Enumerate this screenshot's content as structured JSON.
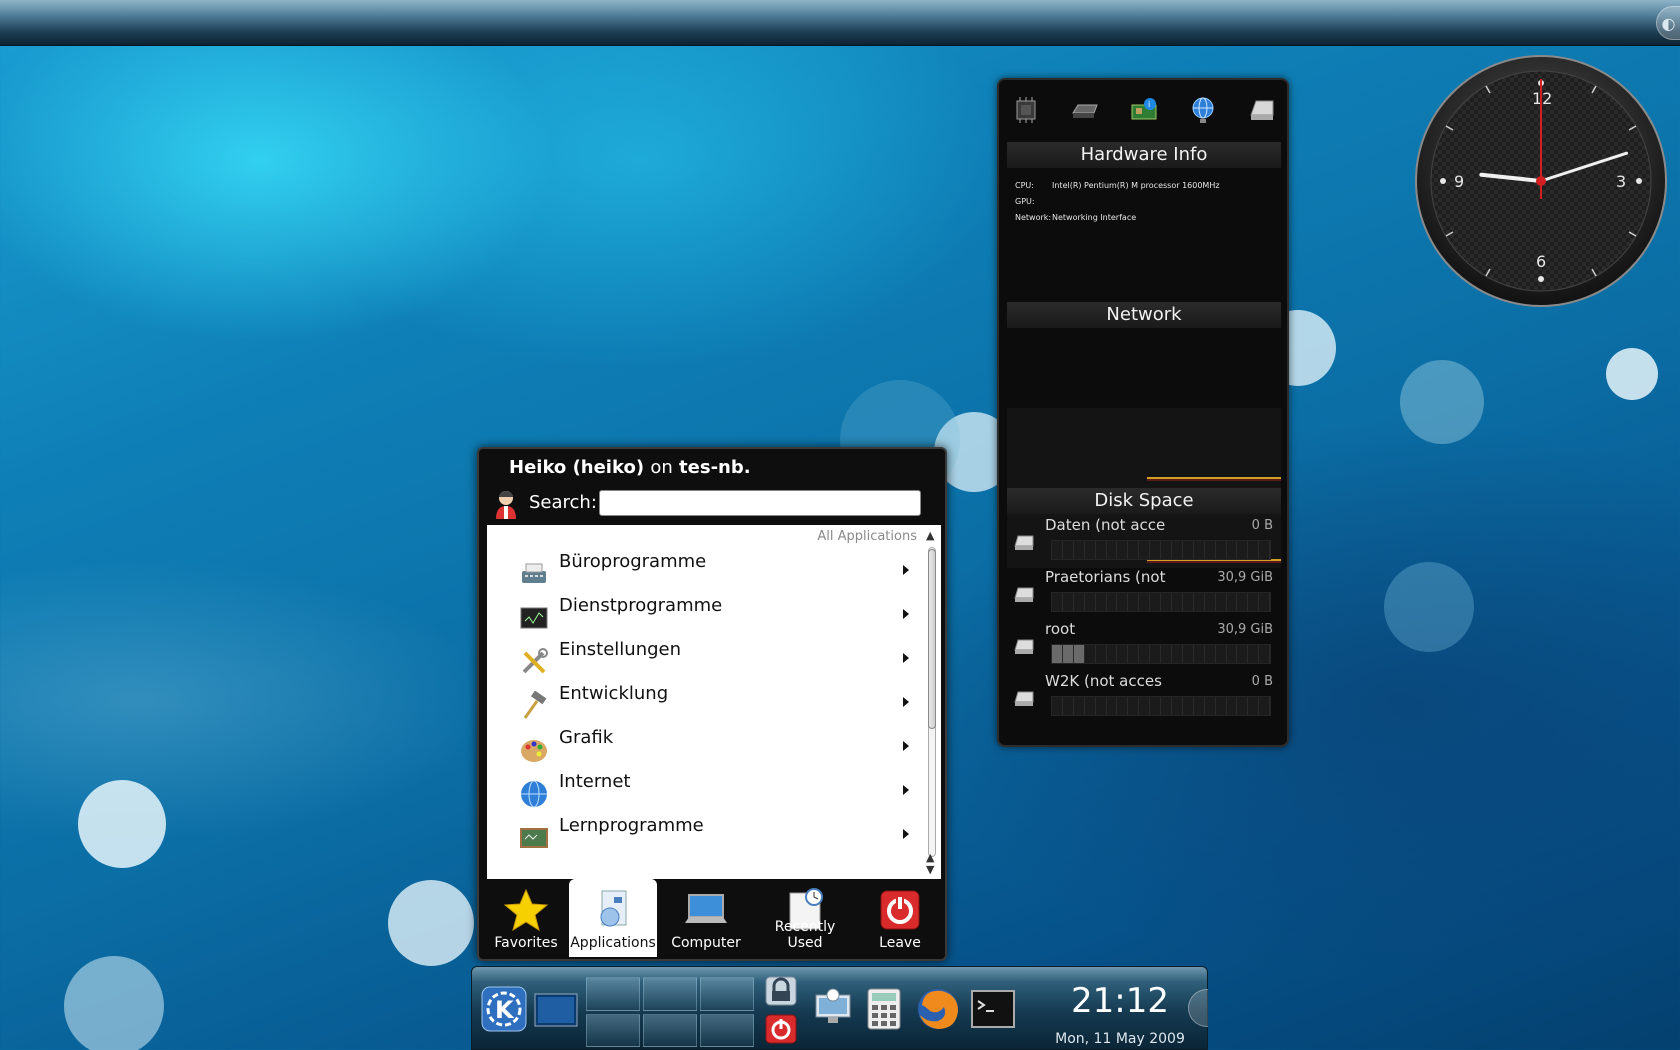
{
  "colors": {
    "wallpaper": "#0e7fb6",
    "widget_bg": "#0c0c0c",
    "network_trace": "#d4a020",
    "clock_second_hand": "#d21f1f",
    "leave_red": "#d92b2b"
  },
  "top_panel": {
    "toolbox_icon": "cashew-icon"
  },
  "hardware_widget": {
    "icons": [
      "cpu-icon",
      "gpu-icon",
      "network-card-icon",
      "globe-icon",
      "hard-disk-icon"
    ],
    "title": "Hardware Info",
    "info": [
      {
        "key": "CPU:",
        "value": "Intel(R) Pentium(R) M processor 1600MHz"
      },
      {
        "key": "GPU:",
        "value": ""
      },
      {
        "key": "Network:",
        "value": "Networking Interface"
      }
    ],
    "network_title": "Network",
    "disk_title": "Disk Space",
    "disks": [
      {
        "name": "Daten (not acce",
        "size": "0 B",
        "used_fraction": 0
      },
      {
        "name": "Praetorians (not",
        "size": "30,9 GiB",
        "used_fraction": 0
      },
      {
        "name": "root",
        "size": "30,9 GiB",
        "used_fraction": 0.15
      },
      {
        "name": "W2K (not acces",
        "size": "0 B",
        "used_fraction": 0
      }
    ]
  },
  "clock": {
    "numerals": {
      "twelve": "12",
      "three": "3",
      "six": "6",
      "nine": "9"
    },
    "time": "21:12"
  },
  "kickoff": {
    "user": "Heiko (heiko)",
    "on_word": "on",
    "host": "tes-nb.",
    "search_label": "Search:",
    "search_value": "",
    "breadcrumb": "All Applications",
    "items": [
      {
        "label": "Büroprogramme",
        "icon": "typewriter-icon"
      },
      {
        "label": "Dienstprogramme",
        "icon": "terminal-icon"
      },
      {
        "label": "Einstellungen",
        "icon": "tools-icon"
      },
      {
        "label": "Entwicklung",
        "icon": "hammer-icon"
      },
      {
        "label": "Grafik",
        "icon": "palette-icon"
      },
      {
        "label": "Internet",
        "icon": "globe-icon"
      },
      {
        "label": "Lernprogramme",
        "icon": "chalkboard-icon"
      }
    ],
    "tabs": [
      {
        "label": "Favorites",
        "icon": "star-icon",
        "active": false
      },
      {
        "label": "Applications",
        "icon": "applications-icon",
        "active": true
      },
      {
        "label": "Computer",
        "icon": "computer-icon",
        "active": false
      },
      {
        "label": "Recently Used",
        "icon": "recent-document-icon",
        "active": false
      },
      {
        "label": "Leave",
        "icon": "power-icon",
        "active": false
      }
    ]
  },
  "bottom_panel": {
    "launchers": [
      "kde-menu-icon",
      "show-desktop-icon",
      "lock-screen-icon",
      "logout-icon",
      "network-monitor-icon",
      "calculator-icon",
      "firefox-icon",
      "konsole-icon"
    ],
    "time": "21:12",
    "date": "Mon, 11 May 2009"
  }
}
